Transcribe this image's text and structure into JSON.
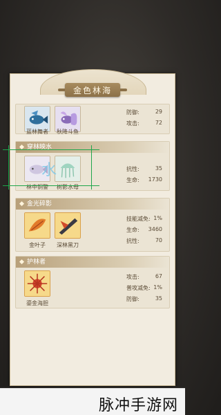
{
  "title": "金色林海",
  "sections": [
    {
      "header": "",
      "cards": [
        {
          "name": "蓝林舞者"
        },
        {
          "name": "秋降斗鱼"
        }
      ],
      "stats": [
        {
          "label": "防御:",
          "value": "29"
        },
        {
          "label": "攻击:",
          "value": "72"
        }
      ]
    },
    {
      "header": "穿林映水",
      "cards": [
        {
          "name": "林中铜警"
        },
        {
          "name": "树影水母"
        }
      ],
      "stats": [
        {
          "label": "抗性:",
          "value": "35"
        },
        {
          "label": "生命:",
          "value": "1730"
        }
      ]
    },
    {
      "header": "金光碎影",
      "cards": [
        {
          "name": "金叶子"
        },
        {
          "name": "深林黑刀"
        }
      ],
      "stats": [
        {
          "label": "技能减免:",
          "value": "1%"
        },
        {
          "label": "生命:",
          "value": "3460"
        },
        {
          "label": "抗性:",
          "value": "70"
        }
      ]
    },
    {
      "header": "护林者",
      "cards": [
        {
          "name": "鎏金海胆"
        }
      ],
      "stats": [
        {
          "label": "攻击:",
          "value": "67"
        },
        {
          "label": "普攻减免:",
          "value": "1%"
        },
        {
          "label": "防御:",
          "value": "35"
        }
      ]
    }
  ],
  "overlay_text": "水",
  "watermark": "脉冲手游网"
}
